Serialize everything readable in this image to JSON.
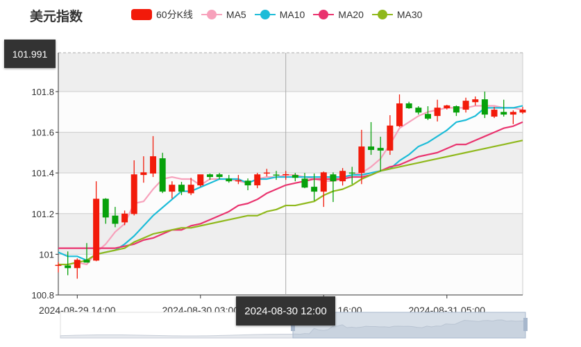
{
  "header": {
    "title": "美元指数"
  },
  "chart_data": {
    "type": "candlestick",
    "title": "美元指数",
    "legend": [
      {
        "name": "60分K线",
        "color": "#f21a0a"
      },
      {
        "name": "MA5",
        "color": "#f7a1bb"
      },
      {
        "name": "MA10",
        "color": "#1cbcd8"
      },
      {
        "name": "MA20",
        "color": "#e9336e"
      },
      {
        "name": "MA30",
        "color": "#8fb81b"
      }
    ],
    "up_color": "#f21a0a",
    "down_color": "#07a10b",
    "ylim": [
      100.8,
      101.991
    ],
    "yticks": [
      "101.8",
      "101.6",
      "101.4",
      "101.2",
      "101",
      "100.8"
    ],
    "ytick_values": [
      101.8,
      101.6,
      101.4,
      101.2,
      101.0,
      100.8
    ],
    "xticks": [
      {
        "index": 2,
        "label": "2024-08-29 14:00"
      },
      {
        "index": 15,
        "label": "2024-08-30 03:00"
      },
      {
        "index": 28,
        "label": "2024-08-30 16:00"
      },
      {
        "index": 41,
        "label": "2024-08-31 05:00"
      }
    ],
    "crosshair": {
      "index": 24,
      "x_label": "2024-08-30 12:00",
      "y_label": "101.991"
    },
    "ohlc": [
      [
        100.945,
        100.962,
        100.911,
        100.948
      ],
      [
        100.945,
        101.014,
        100.897,
        100.932
      ],
      [
        100.932,
        100.98,
        100.88,
        100.973
      ],
      [
        100.973,
        101.055,
        100.966,
        100.959
      ],
      [
        100.969,
        101.359,
        100.966,
        101.273
      ],
      [
        101.273,
        101.276,
        101.15,
        101.181
      ],
      [
        101.19,
        101.233,
        101.133,
        101.15
      ],
      [
        101.157,
        101.215,
        101.143,
        101.2
      ],
      [
        101.198,
        101.462,
        101.191,
        101.393
      ],
      [
        101.39,
        101.482,
        101.352,
        101.403
      ],
      [
        101.397,
        101.581,
        101.38,
        101.482
      ],
      [
        101.472,
        101.499,
        101.301,
        101.308
      ],
      [
        101.308,
        101.359,
        101.274,
        101.342
      ],
      [
        101.342,
        101.356,
        101.291,
        101.308
      ],
      [
        101.3,
        101.376,
        101.291,
        101.342
      ],
      [
        101.339,
        101.383,
        101.332,
        101.393
      ],
      [
        101.393,
        101.397,
        101.366,
        101.38
      ],
      [
        101.393,
        101.4,
        101.369,
        101.38
      ],
      [
        101.372,
        101.39,
        101.352,
        101.359
      ],
      [
        101.36,
        101.39,
        101.345,
        101.364
      ],
      [
        101.362,
        101.373,
        101.315,
        101.339
      ],
      [
        101.339,
        101.4,
        101.325,
        101.393
      ],
      [
        101.398,
        101.42,
        101.383,
        101.402
      ],
      [
        101.392,
        101.41,
        101.366,
        101.388
      ],
      [
        101.39,
        101.41,
        101.366,
        101.394
      ],
      [
        101.39,
        101.4,
        101.359,
        101.376
      ],
      [
        101.372,
        101.4,
        101.325,
        101.328
      ],
      [
        101.332,
        101.397,
        101.264,
        101.308
      ],
      [
        101.308,
        101.407,
        101.233,
        101.403
      ],
      [
        101.393,
        101.403,
        101.257,
        101.359
      ],
      [
        101.359,
        101.424,
        101.338,
        101.41
      ],
      [
        101.402,
        101.43,
        101.345,
        101.398
      ],
      [
        101.4,
        101.612,
        101.345,
        101.53
      ],
      [
        101.53,
        101.65,
        101.489,
        101.513
      ],
      [
        101.523,
        101.578,
        101.407,
        101.51
      ],
      [
        101.51,
        101.684,
        101.489,
        101.633
      ],
      [
        101.63,
        101.786,
        101.626,
        101.742
      ],
      [
        101.742,
        101.75,
        101.715,
        101.718
      ],
      [
        101.721,
        101.728,
        101.687,
        101.697
      ],
      [
        101.69,
        101.728,
        101.66,
        101.667
      ],
      [
        101.68,
        101.76,
        101.653,
        101.721
      ],
      [
        101.718,
        101.735,
        101.712,
        101.732
      ],
      [
        101.728,
        101.732,
        101.68,
        101.697
      ],
      [
        101.711,
        101.77,
        101.697,
        101.755
      ],
      [
        101.748,
        101.776,
        101.732,
        101.762
      ],
      [
        101.762,
        101.8,
        101.67,
        101.687
      ],
      [
        101.677,
        101.725,
        101.67,
        101.711
      ],
      [
        101.7,
        101.76,
        101.677,
        101.687
      ],
      [
        101.687,
        101.708,
        101.64,
        101.7
      ],
      [
        101.697,
        101.725,
        101.69,
        101.711
      ]
    ],
    "ma": {
      "MA5": [
        100.95,
        100.95,
        100.96,
        100.95,
        101.01,
        101.05,
        101.11,
        101.15,
        101.25,
        101.26,
        101.32,
        101.37,
        101.38,
        101.37,
        101.37,
        101.34,
        101.37,
        101.37,
        101.37,
        101.36,
        101.35,
        101.37,
        101.38,
        101.38,
        101.39,
        101.39,
        101.38,
        101.37,
        101.36,
        101.36,
        101.37,
        101.39,
        101.4,
        101.43,
        101.47,
        101.54,
        101.62,
        101.65,
        101.68,
        101.7,
        101.71,
        101.72,
        101.72,
        101.72,
        101.73,
        101.73,
        101.73,
        101.72,
        101.72,
        101.71
      ],
      "MA10": [
        101.01,
        100.99,
        100.99,
        100.97,
        101.0,
        101.01,
        101.02,
        101.05,
        101.09,
        101.14,
        101.19,
        101.23,
        101.27,
        101.31,
        101.31,
        101.33,
        101.35,
        101.37,
        101.37,
        101.37,
        101.35,
        101.37,
        101.37,
        101.38,
        101.38,
        101.38,
        101.38,
        101.38,
        101.38,
        101.38,
        101.38,
        101.39,
        101.39,
        101.4,
        101.41,
        101.42,
        101.46,
        101.49,
        101.53,
        101.55,
        101.58,
        101.61,
        101.65,
        101.66,
        101.68,
        101.72,
        101.72,
        101.72,
        101.72,
        101.73
      ],
      "MA20": [
        101.03,
        101.03,
        101.03,
        101.03,
        101.03,
        101.03,
        101.03,
        101.04,
        101.05,
        101.07,
        101.08,
        101.1,
        101.12,
        101.12,
        101.14,
        101.15,
        101.17,
        101.19,
        101.21,
        101.24,
        101.25,
        101.27,
        101.3,
        101.32,
        101.34,
        101.35,
        101.36,
        101.37,
        101.37,
        101.37,
        101.37,
        101.38,
        101.38,
        101.39,
        101.41,
        101.43,
        101.44,
        101.46,
        101.48,
        101.49,
        101.5,
        101.52,
        101.54,
        101.54,
        101.56,
        101.58,
        101.6,
        101.62,
        101.63,
        101.65
      ],
      "MA30": [
        100.95,
        100.95,
        100.96,
        100.97,
        101.0,
        101.01,
        101.02,
        101.03,
        101.06,
        101.08,
        101.1,
        101.11,
        101.12,
        101.13,
        101.13,
        101.14,
        101.15,
        101.16,
        101.17,
        101.18,
        101.19,
        101.19,
        101.21,
        101.22,
        101.24,
        101.24,
        101.25,
        101.26,
        101.29,
        101.31,
        101.32,
        101.34,
        101.37,
        101.39,
        101.41,
        101.42,
        101.43,
        101.44,
        101.45,
        101.46,
        101.47,
        101.48,
        101.49,
        101.5,
        101.51,
        101.52,
        101.53,
        101.54,
        101.55,
        101.56
      ]
    },
    "datazoom": {
      "start_percent": 50,
      "end_percent": 100
    }
  }
}
